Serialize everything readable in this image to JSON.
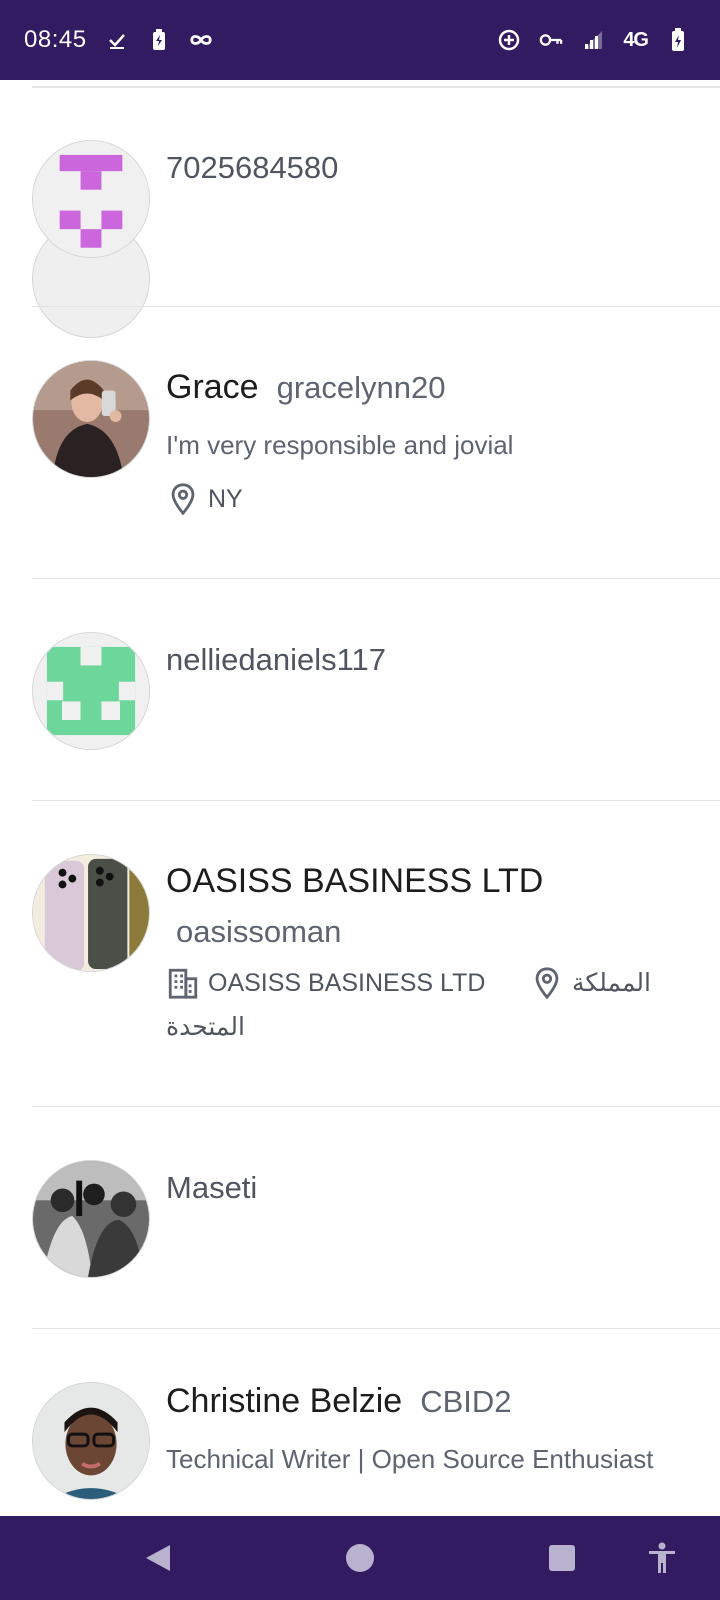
{
  "status_bar": {
    "time": "08:45",
    "network": "4G",
    "left_icons": [
      "check-icon",
      "battery-saver-icon",
      "infinity-icon"
    ],
    "right_icons": [
      "data-saver-icon",
      "vpn-key-icon",
      "signal-icon",
      "battery-icon"
    ]
  },
  "colors": {
    "bar_bg": "#321b60",
    "identicon_purple": "#cc66dd",
    "identicon_green": "#6dd69a"
  },
  "users": [
    {
      "name": "7025684580",
      "avatar": "identicon-purple"
    },
    {
      "name": "Grace",
      "handle": "gracelynn20",
      "bio": "I'm very responsible and jovial",
      "location": "NY",
      "avatar": "photo"
    },
    {
      "name": "nelliedaniels117",
      "avatar": "identicon-green"
    },
    {
      "name": "OASISS BASINESS LTD",
      "handle": "oasissoman",
      "company": "OASISS BASINESS LTD",
      "location_line1": "المملكة",
      "location_line2": "المتحدة",
      "avatar": "photo"
    },
    {
      "name": "Maseti",
      "avatar": "photo"
    },
    {
      "name": "Christine Belzie",
      "handle": "CBID2",
      "bio": "Technical Writer | Open Source Enthusiast",
      "avatar": "photo"
    }
  ],
  "nav_bar": {
    "buttons": [
      "back-icon",
      "home-icon",
      "recents-icon",
      "accessibility-icon"
    ]
  }
}
